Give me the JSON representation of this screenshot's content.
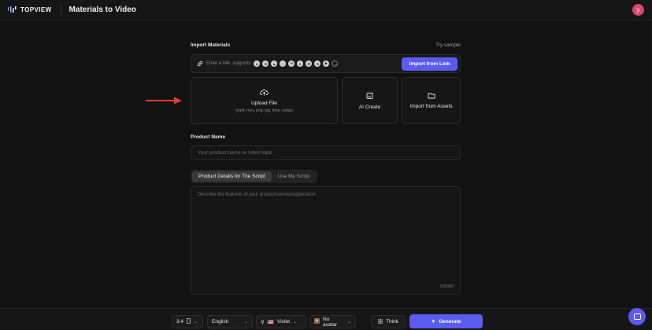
{
  "app": {
    "logo_text": "TOPVIEW",
    "page_title": "Materials to Video",
    "user_initial": "y"
  },
  "import": {
    "label": "Import Materials",
    "try_sample": "Try sample",
    "link_placeholder": "Enter a link, supports",
    "platform_icons": [
      "amazon-icon",
      "shopify-icon",
      "shop-bag-icon",
      "store-icon",
      "mail-icon",
      "ebay-icon",
      "etsy-icon",
      "appstore-icon",
      "play-store-icon"
    ],
    "import_link_label": "Import from Link"
  },
  "cards": {
    "upload_title": "Upload File",
    "upload_formats": "(mp4, mov, png, jpg, bmp, webp)",
    "ai_create": "AI Create",
    "import_assets": "Import from Assets"
  },
  "product": {
    "label": "Product Name",
    "placeholder": "Your product name or video topic"
  },
  "script": {
    "tabs": [
      "Product Details for The Script",
      "Use My Script"
    ],
    "active_tab": 0,
    "placeholder": "Describe the features of your product/service/application.",
    "counter": "0/5000"
  },
  "bottom": {
    "ratio": "3:4",
    "language": "English",
    "voice": "Violet",
    "avatar": "No avatar",
    "think": "Think",
    "generate": "Generate"
  },
  "colors": {
    "accent": "#5b5bf0",
    "arrow": "#e8402a",
    "avatar_bg": "#d9466f"
  }
}
